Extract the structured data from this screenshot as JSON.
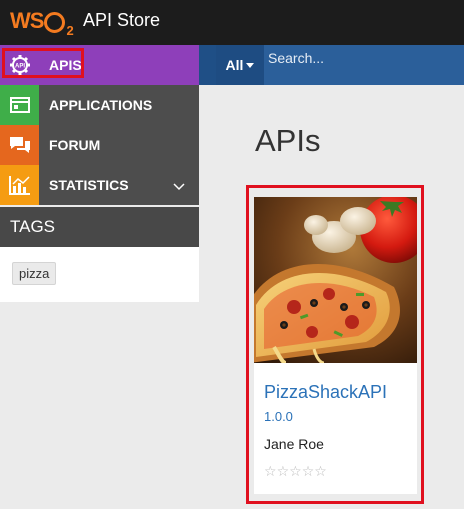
{
  "header": {
    "logo_text": "WSO2",
    "title": "API Store"
  },
  "sidebar": {
    "items": [
      {
        "label": "APIS",
        "icon": "gear-api-icon",
        "active": true
      },
      {
        "label": "APPLICATIONS",
        "icon": "application-window-icon"
      },
      {
        "label": "FORUM",
        "icon": "chat-bubbles-icon"
      },
      {
        "label": "STATISTICS",
        "icon": "bar-chart-icon",
        "has_submenu": true
      }
    ],
    "tags": {
      "heading": "TAGS",
      "items": [
        "pizza"
      ]
    }
  },
  "search": {
    "filter_label": "All",
    "placeholder": "Search..."
  },
  "main": {
    "page_title": "APIs",
    "cards": [
      {
        "name": "PizzaShackAPI",
        "version": "1.0.0",
        "owner": "Jane Roe",
        "rating_stars": 0,
        "rating_max": 5,
        "image": "pizza-thumbnail"
      }
    ]
  },
  "colors": {
    "topbar": "#1c1c1c",
    "active_nav": "#8e3fba",
    "nav_bg": "#4d4d4d",
    "search_bar": "#2b5f9a",
    "link_blue": "#2b72b8",
    "highlight_red": "#e0101f"
  }
}
